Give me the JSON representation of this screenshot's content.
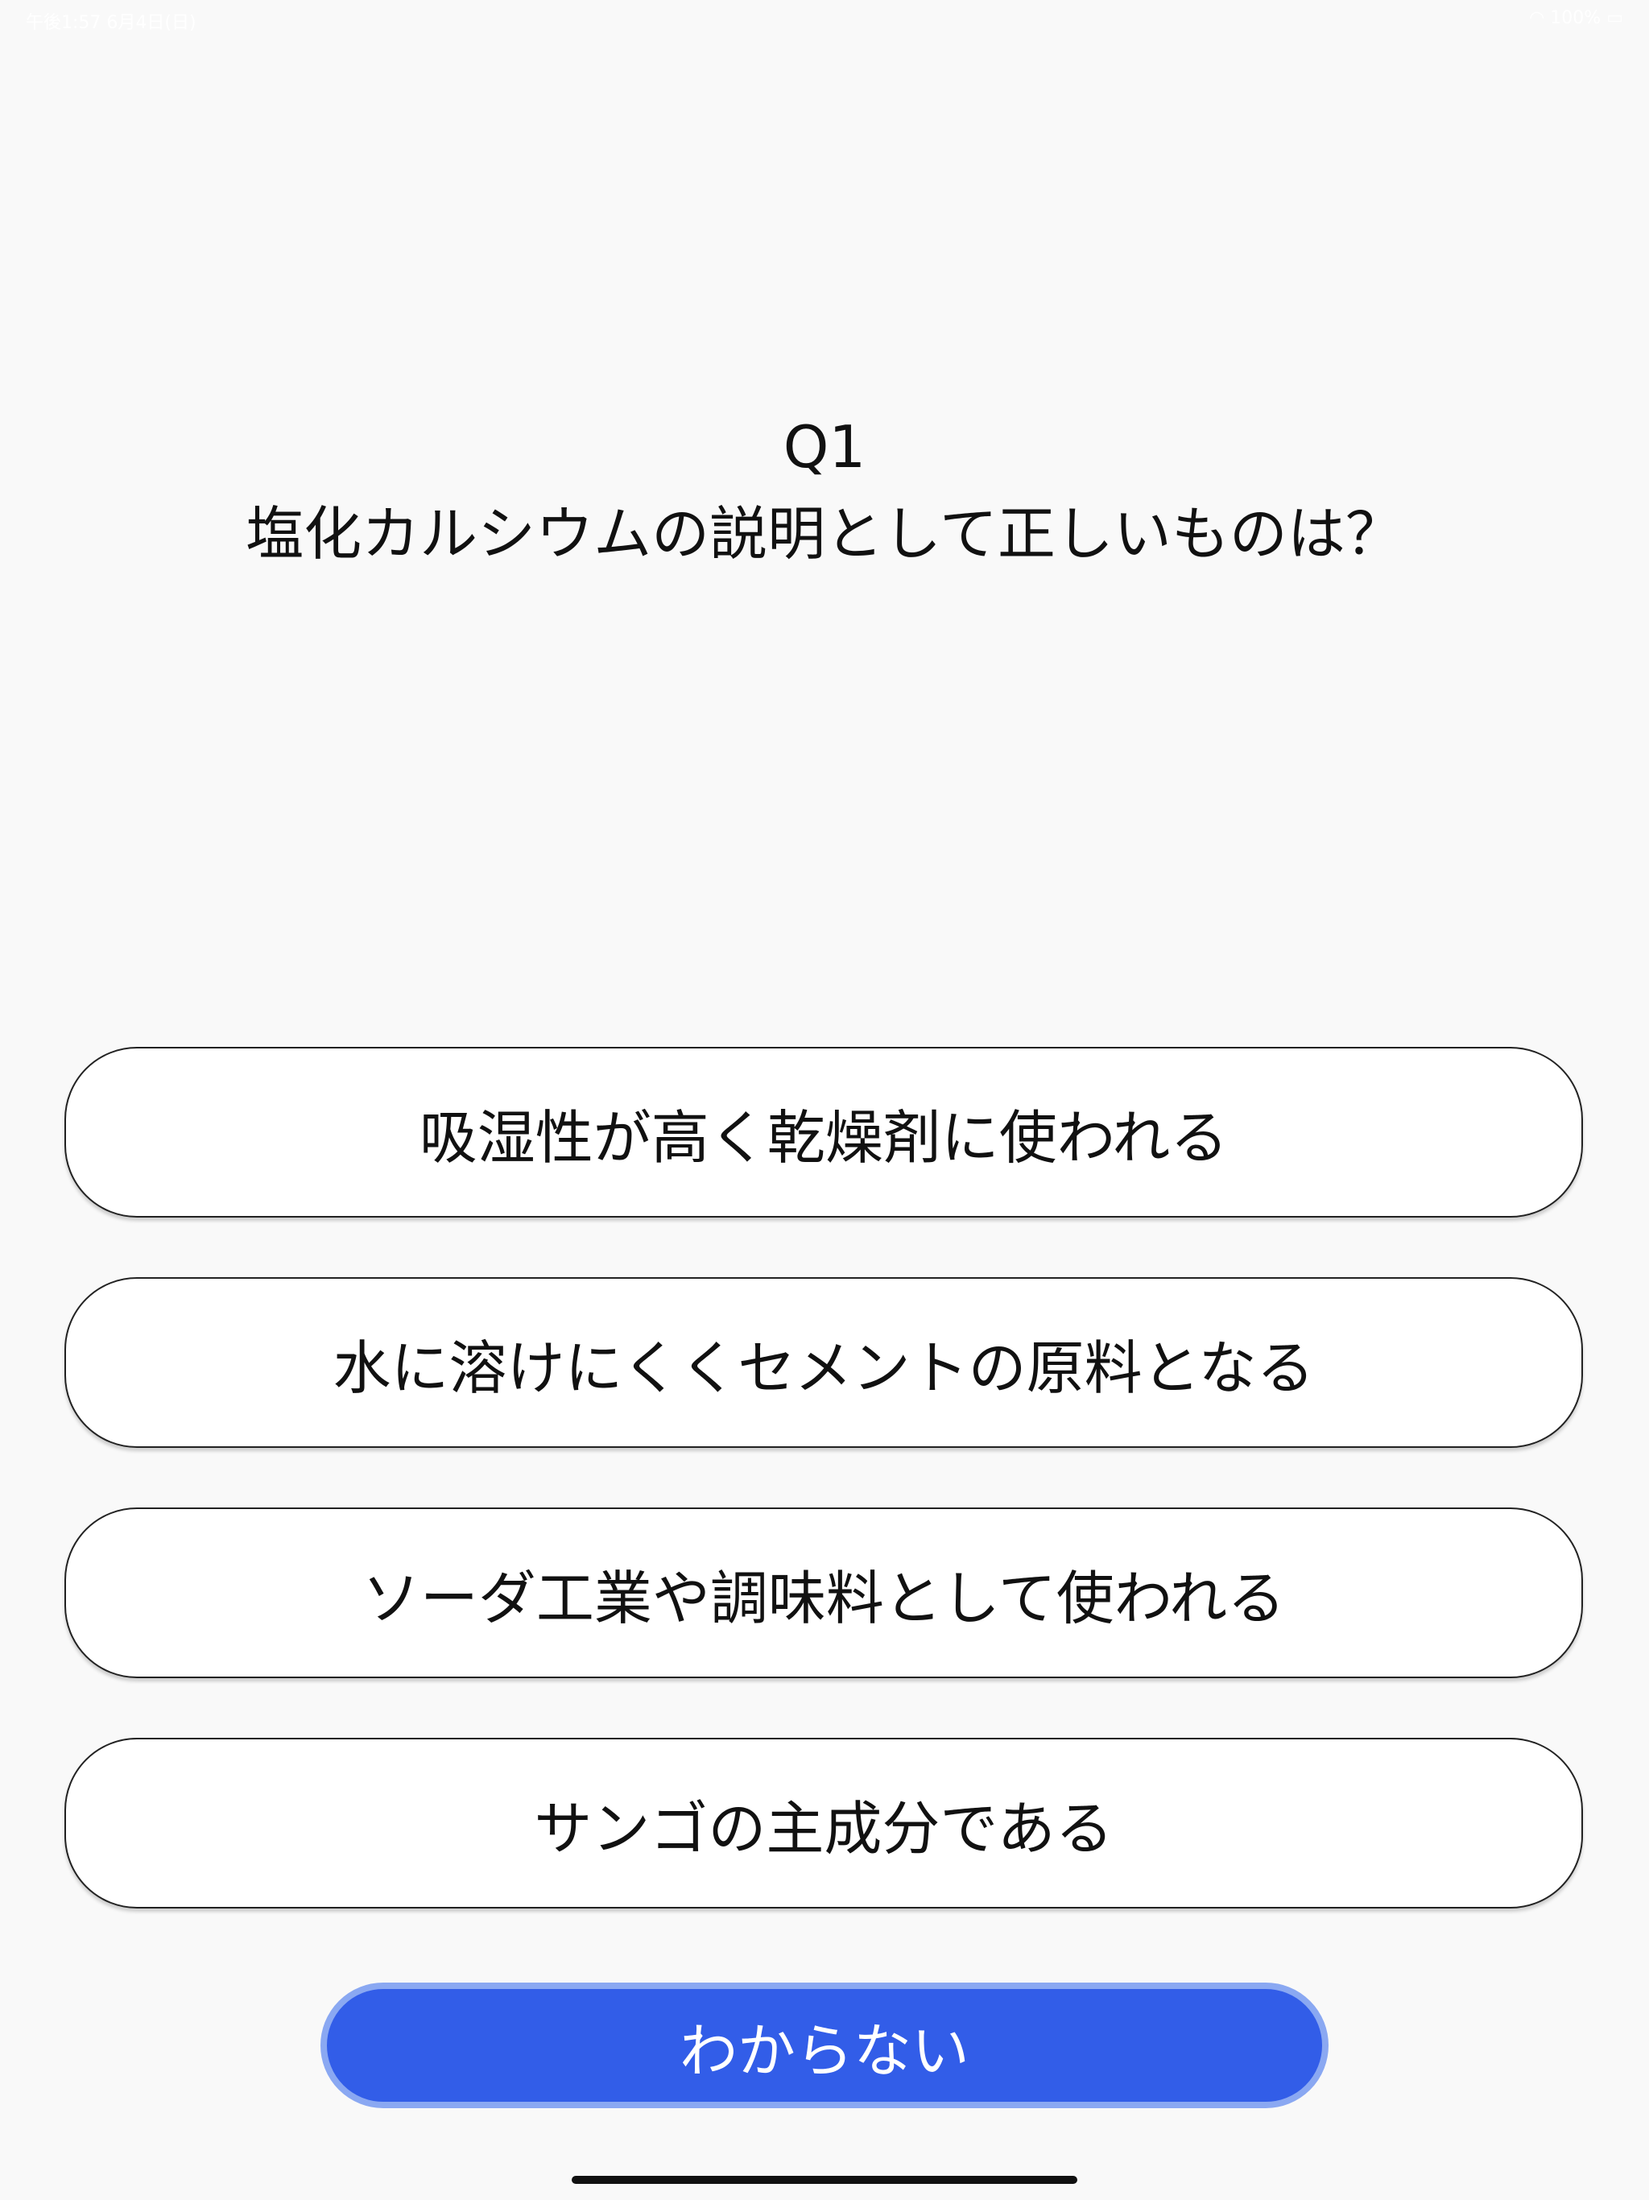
{
  "status_bar": {
    "time_date": "午後1:57 6月4日(日)",
    "battery": "100%",
    "wifi_icon": "wifi-icon",
    "battery_icon": "battery-icon"
  },
  "question": {
    "number": "Q1",
    "text": "塩化カルシウムの説明として正しいものは？"
  },
  "answers": [
    {
      "label": "吸湿性が高く乾燥剤に使われる"
    },
    {
      "label": "水に溶けにくくセメントの原料となる"
    },
    {
      "label": "ソーダ工業や調味料として使われる"
    },
    {
      "label": "サンゴの主成分である"
    }
  ],
  "dont_know_button": {
    "label": "わからない"
  },
  "colors": {
    "background": "#f9f9f9",
    "option_background": "#ffffff",
    "option_border": "#222222",
    "primary_button": "#325de8",
    "primary_button_border": "#8aa8f2",
    "text": "#111111"
  }
}
